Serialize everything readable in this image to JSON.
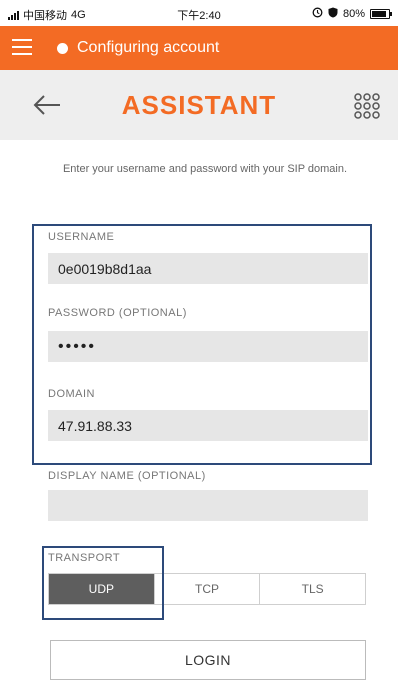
{
  "status_bar": {
    "carrier": "中国移动",
    "network": "4G",
    "time": "下午2:40",
    "battery": "80%"
  },
  "top_bar": {
    "status_text": "Configuring account"
  },
  "toolbar": {
    "title": "ASSISTANT"
  },
  "instructions": "Enter your username and password with your SIP domain.",
  "form": {
    "username": {
      "label": "USERNAME",
      "value": "0e0019b8d1aa"
    },
    "password": {
      "label": "PASSWORD (OPTIONAL)",
      "value": "•••••"
    },
    "domain": {
      "label": "DOMAIN",
      "value": "47.91.88.33"
    },
    "display_name": {
      "label": "DISPLAY NAME (OPTIONAL)",
      "value": ""
    },
    "transport": {
      "label": "TRANSPORT",
      "options": [
        "UDP",
        "TCP",
        "TLS"
      ],
      "selected": "UDP"
    }
  },
  "login_label": "LOGIN"
}
